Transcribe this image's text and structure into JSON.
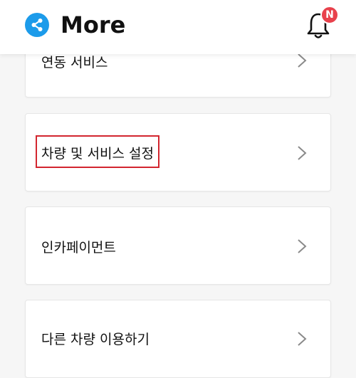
{
  "header": {
    "title": "More",
    "share_icon": "share-icon",
    "bell_icon": "bell-icon",
    "badge": "N"
  },
  "menu": {
    "items": [
      {
        "label": "연동 서비스"
      },
      {
        "label": "차량 및 서비스 설정",
        "highlighted": true
      },
      {
        "label": "인카페이먼트"
      },
      {
        "label": "다른 차량 이용하기"
      }
    ]
  },
  "colors": {
    "accent": "#1c9bea",
    "badge": "#e8414c",
    "highlight_border": "#d3262f",
    "background": "#f6f6f6"
  }
}
